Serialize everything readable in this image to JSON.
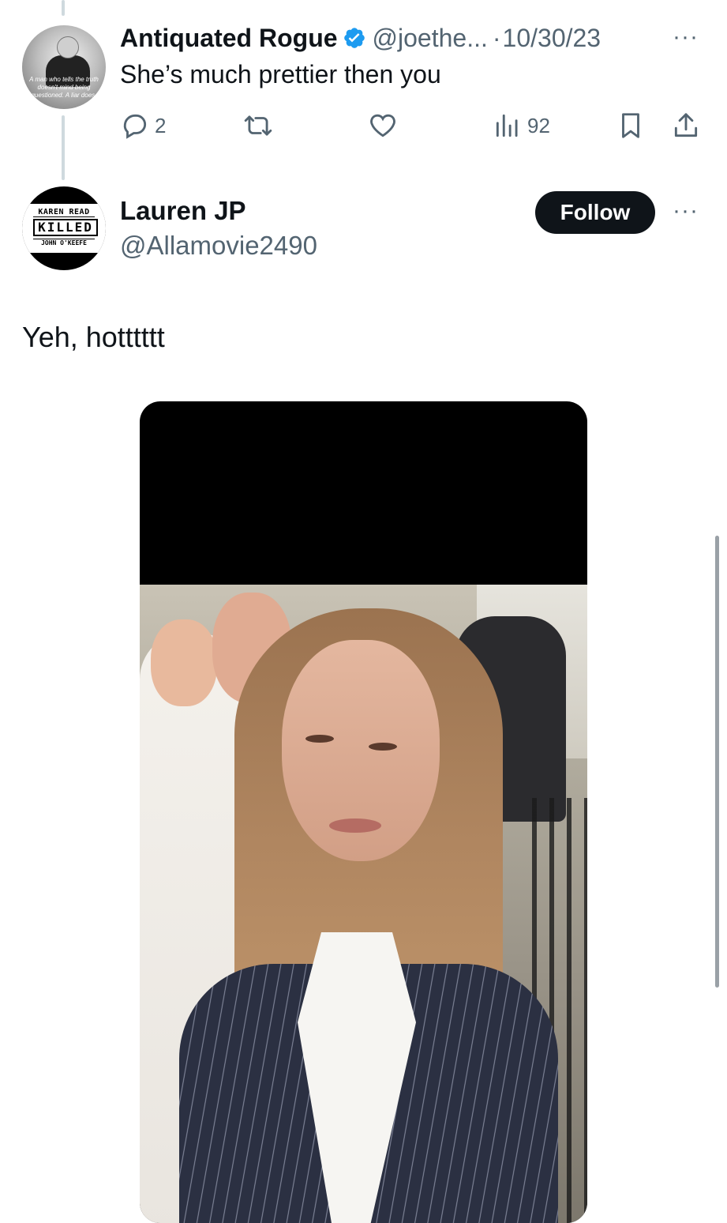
{
  "reply_tweet": {
    "display_name": "Antiquated Rogue",
    "handle": "@joethe...",
    "separator": "·",
    "date": "10/30/23",
    "text": "She’s much prettier then you",
    "avatar_caption": "A man who tells the truth doesn't mind being questioned. A liar does.",
    "verified_icon": "verified-badge-icon",
    "actions": {
      "reply_count": "2",
      "retweet_count": "",
      "like_count": "",
      "views_count": "92"
    },
    "more_label": "···"
  },
  "main_tweet": {
    "display_name": "Lauren JP",
    "handle": "@Allamovie2490",
    "follow_label": "Follow",
    "more_label": "···",
    "text": "Yeh, hotttttt",
    "avatar_badge": {
      "line1": "KAREN READ",
      "line2": "KILLED",
      "line3": "JOHN O'KEEFE"
    }
  },
  "colors": {
    "text_primary": "#0f1419",
    "text_secondary": "#536471",
    "verified_blue": "#1d9bf0",
    "follow_bg": "#0f1419",
    "thread_line": "#cfd9de"
  }
}
